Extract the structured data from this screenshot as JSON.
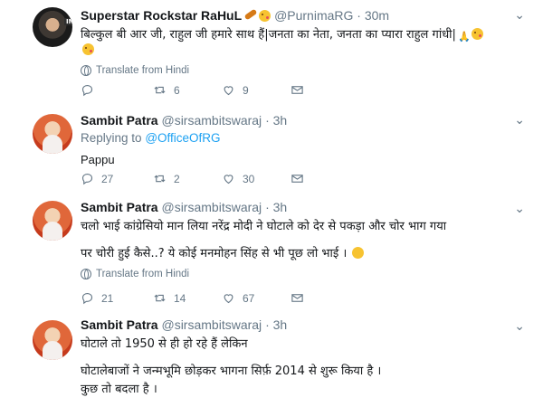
{
  "tweets": [
    {
      "name": "Superstar Rockstar RaHuL",
      "avatar_label": "INDIA",
      "handle": "@PurnimaRG",
      "dot": "·",
      "time": "30m",
      "text": "बिल्कुल बी आर जी, राहुल जी हमारे साथ हैं|जनता का नेता, जनता का प्यारा राहुल गांधी|",
      "translate": "Translate from Hindi",
      "replies": "",
      "retweets": "6",
      "likes": "9"
    },
    {
      "name": "Sambit Patra",
      "handle": "@sirsambitswaraj",
      "dot": "·",
      "time": "3h",
      "replying_label": "Replying to",
      "replying_to": "@OfficeOfRG",
      "text": "Pappu",
      "replies": "27",
      "retweets": "2",
      "likes": "30"
    },
    {
      "name": "Sambit Patra",
      "handle": "@sirsambitswaraj",
      "dot": "·",
      "time": "3h",
      "text1": "चलो भाई कांग्रेसियो मान लिया नरेंद्र मोदी ने घोटाले को देर से पकड़ा और चोर भाग गया",
      "text2": "पर चोरी हुई कैसे..? ये कोई मनमोहन सिंह से भी पूछ लो भाई ।",
      "translate": "Translate from Hindi",
      "replies": "21",
      "retweets": "14",
      "likes": "67"
    },
    {
      "name": "Sambit Patra",
      "handle": "@sirsambitswaraj",
      "dot": "·",
      "time": "3h",
      "text1": "घोटाले तो 1950 से ही हो रहे हैं लेकिन",
      "text2": "घोटालेबाजों ने जन्मभूमि छोड़कर भागना सिर्फ़ 2014 से शुरू किया है ।",
      "text3": "कुछ तो बदला है ।"
    }
  ],
  "colors": {
    "accent": "#1da1f2",
    "muted": "#657786",
    "border": "#e6ecf0"
  },
  "icons": [
    "reply-icon",
    "retweet-icon",
    "like-icon",
    "message-icon",
    "globe-icon",
    "chevron-down-icon"
  ]
}
